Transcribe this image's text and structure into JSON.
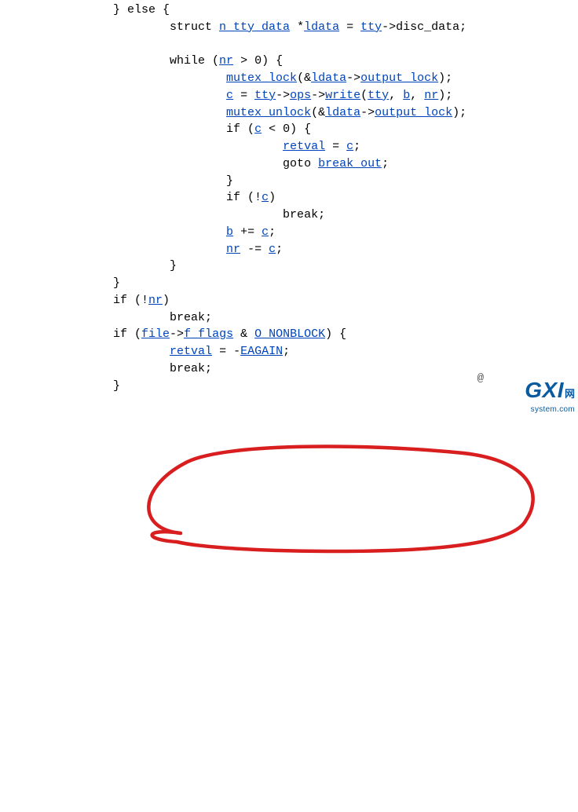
{
  "code": {
    "l1a": "                } else {",
    "l2a": "                        struct ",
    "l2b": "n_tty_data",
    "l2c": " *",
    "l2d": "ldata",
    "l2e": " = ",
    "l2f": "tty",
    "l2g": "->disc_data;",
    "l3": "",
    "l4a": "                        while (",
    "l4b": "nr",
    "l4c": " > 0) {",
    "l5a": "                                ",
    "l5b": "mutex_lock",
    "l5c": "(&",
    "l5d": "ldata",
    "l5e": "->",
    "l5f": "output_lock",
    "l5g": ");",
    "l6a": "                                ",
    "l6b": "c",
    "l6c": " = ",
    "l6d": "tty",
    "l6e": "->",
    "l6f": "ops",
    "l6g": "->",
    "l6h": "write",
    "l6i": "(",
    "l6j": "tty",
    "l6k": ", ",
    "l6l": "b",
    "l6m": ", ",
    "l6n": "nr",
    "l6o": ");",
    "l7a": "                                ",
    "l7b": "mutex_unlock",
    "l7c": "(&",
    "l7d": "ldata",
    "l7e": "->",
    "l7f": "output_lock",
    "l7g": ");",
    "l8a": "                                if (",
    "l8b": "c",
    "l8c": " < 0) {",
    "l9a": "                                        ",
    "l9b": "retval",
    "l9c": " = ",
    "l9d": "c",
    "l9e": ";",
    "l10a": "                                        goto ",
    "l10b": "break_out",
    "l10c": ";",
    "l11a": "                                }",
    "l12a": "                                if (!",
    "l12b": "c",
    "l12c": ")",
    "l13a": "                                        break;",
    "l14a": "                                ",
    "l14b": "b",
    "l14c": " += ",
    "l14d": "c",
    "l14e": ";",
    "l15a": "                                ",
    "l15b": "nr",
    "l15c": " -= ",
    "l15d": "c",
    "l15e": ";",
    "l16a": "                        }",
    "l17a": "                }",
    "l18a": "                if (!",
    "l18b": "nr",
    "l18c": ")",
    "l19a": "                        break;",
    "l20a": "                if (",
    "l20b": "file",
    "l20c": "->",
    "l20d": "f_flags",
    "l20e": " & ",
    "l20f": "O_NONBLOCK",
    "l20g": ") {",
    "l21a": "                        ",
    "l21b": "retval",
    "l21c": " = -",
    "l21d": "EAGAIN",
    "l21e": ";",
    "l22a": "                        break;",
    "l23a": "                }"
  },
  "annotation": {
    "pen_color": "#d81e1e"
  },
  "watermark": {
    "big": "GXI",
    "small": "网",
    "sub": "system.com",
    "at": "@"
  }
}
